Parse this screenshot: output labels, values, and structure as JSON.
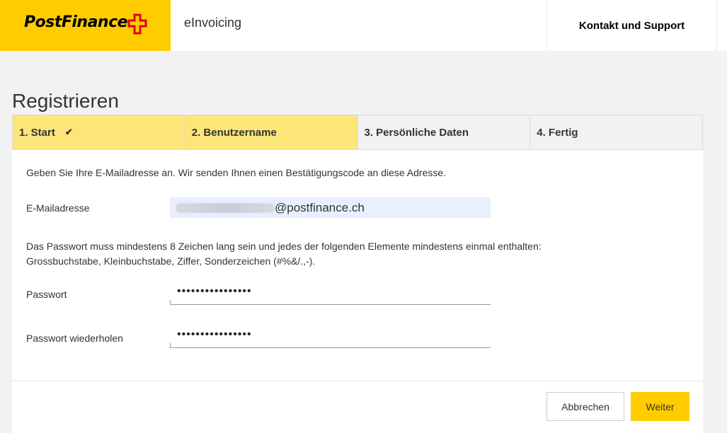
{
  "header": {
    "logo_text": "PostFinance",
    "app_name": "eInvoicing",
    "support_label": "Kontakt und Support",
    "brand_color": "#ffcc00",
    "cross_color": "#e2001a"
  },
  "page": {
    "title": "Registrieren"
  },
  "steps": [
    {
      "label": "1. Start",
      "done": true,
      "active": true
    },
    {
      "label": "2. Benutzername",
      "active": true
    },
    {
      "label": "3. Persönliche Daten",
      "active": false
    },
    {
      "label": "4. Fertig",
      "active": false
    }
  ],
  "step_check_glyph": "✔",
  "form": {
    "intro": "Geben Sie Ihre E-Mailadresse an. Wir senden Ihnen einen Bestätigungscode an diese Adresse.",
    "email_label": "E-Mailadresse",
    "email_value_suffix": "@postfinance.ch",
    "password_rules_line1": "Das Passwort muss mindestens 8 Zeichen lang sein und jedes der folgenden Elemente mindestens einmal enthalten:",
    "password_rules_line2": "Grossbuchstabe, Kleinbuchstabe, Ziffer, Sonderzeichen (#%&/.,-).",
    "password_label": "Passwort",
    "password_value": "••••••••••••••••",
    "password_repeat_label": "Passwort wiederholen",
    "password_repeat_value": "••••••••••••••••"
  },
  "actions": {
    "cancel_label": "Abbrechen",
    "next_label": "Weiter"
  }
}
